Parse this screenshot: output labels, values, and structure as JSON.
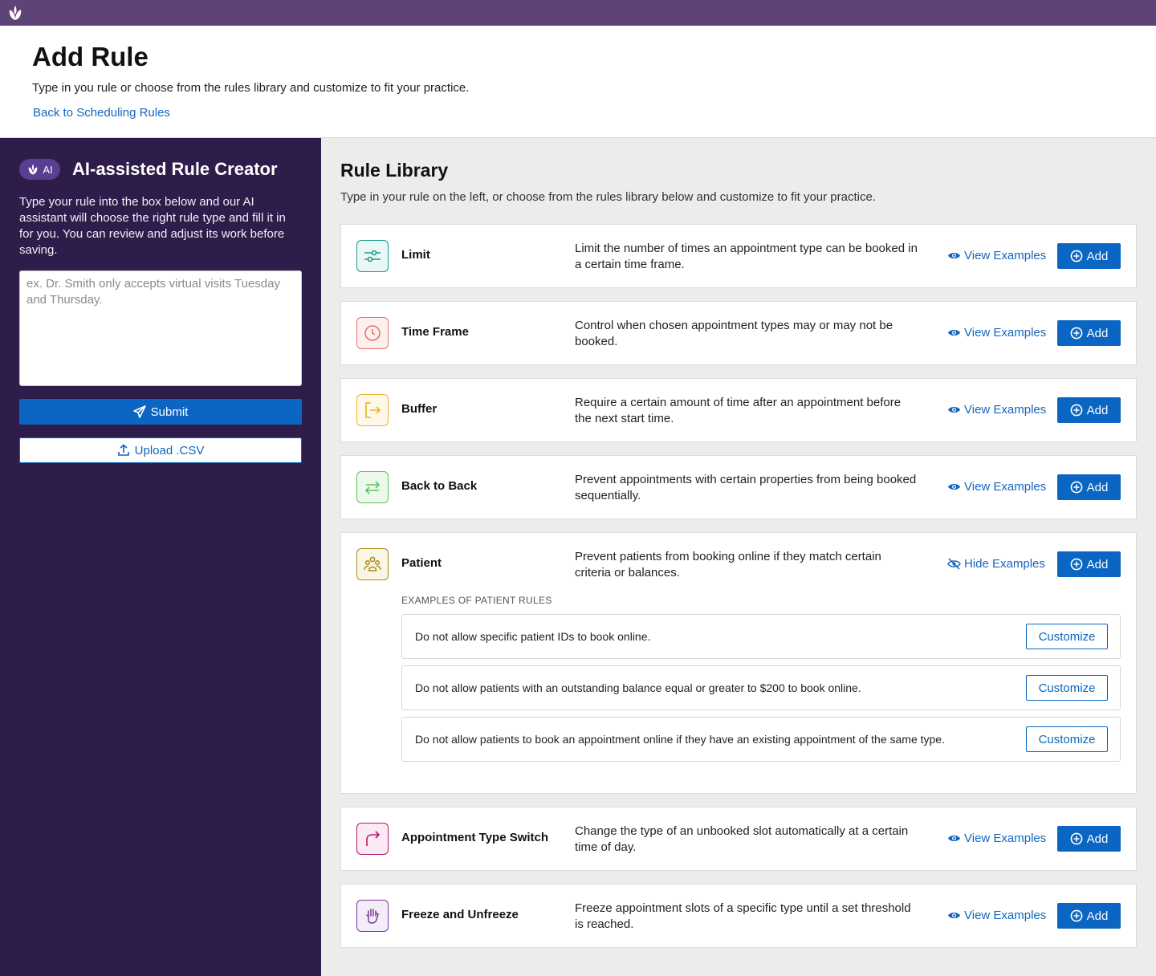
{
  "header": {
    "title": "Add Rule",
    "subtitle": "Type in you rule or choose from the rules library and customize to fit your practice.",
    "back_link": "Back to Scheduling Rules"
  },
  "sidebar": {
    "badge": "AI",
    "title": "AI-assisted Rule Creator",
    "description": "Type your rule into the box below and our AI assistant will choose the right rule type and fill it in for you. You can review and adjust its work before saving.",
    "input_value": "",
    "input_placeholder": "ex. Dr. Smith only accepts virtual visits Tuesday and Thursday.",
    "submit_label": "Submit",
    "upload_label": "Upload .CSV"
  },
  "library": {
    "title": "Rule Library",
    "subtitle": "Type in your rule on the left, or choose from the rules library below and customize to fit your practice.",
    "add_label": "Add",
    "rules": [
      {
        "name": "Limit",
        "description": "Limit the number of times an appointment type can be booked in a certain time frame.",
        "examples_link": "View Examples",
        "icon": "sliders-icon",
        "color": "#1a9a8a"
      },
      {
        "name": "Time Frame",
        "description": "Control when chosen appointment types may or may not be booked.",
        "examples_link": "View Examples",
        "icon": "clock-icon",
        "color": "#e8726a"
      },
      {
        "name": "Buffer",
        "description": "Require a certain amount of time after an appointment before the next start time.",
        "examples_link": "View Examples",
        "icon": "exit-arrow-icon",
        "color": "#e8b52a"
      },
      {
        "name": "Back to Back",
        "description": "Prevent appointments with certain properties from being booked sequentially.",
        "examples_link": "View Examples",
        "icon": "swap-arrows-icon",
        "color": "#5cc45c"
      },
      {
        "name": "Patient",
        "description": "Prevent patients from booking online if they match certain criteria or balances.",
        "examples_link": "Hide Examples",
        "icon": "people-icon",
        "color": "#a88a1a",
        "examples_label": "EXAMPLES OF PATIENT RULES",
        "customize_label": "Customize",
        "examples": [
          "Do not allow specific patient IDs to book online.",
          "Do not allow patients with an outstanding balance equal or greater to $200 to book online.",
          "Do not allow patients to book an appointment online if they have an existing appointment of the same type."
        ]
      },
      {
        "name": "Appointment Type Switch",
        "description": "Change the type of an unbooked slot automatically at a certain time of day.",
        "examples_link": "View Examples",
        "icon": "redirect-arrow-icon",
        "color": "#b5176a"
      },
      {
        "name": "Freeze and Unfreeze",
        "description": "Freeze appointment slots of a specific type until a set threshold is reached.",
        "examples_link": "View Examples",
        "icon": "hand-icon",
        "color": "#7a3a9a"
      }
    ]
  }
}
